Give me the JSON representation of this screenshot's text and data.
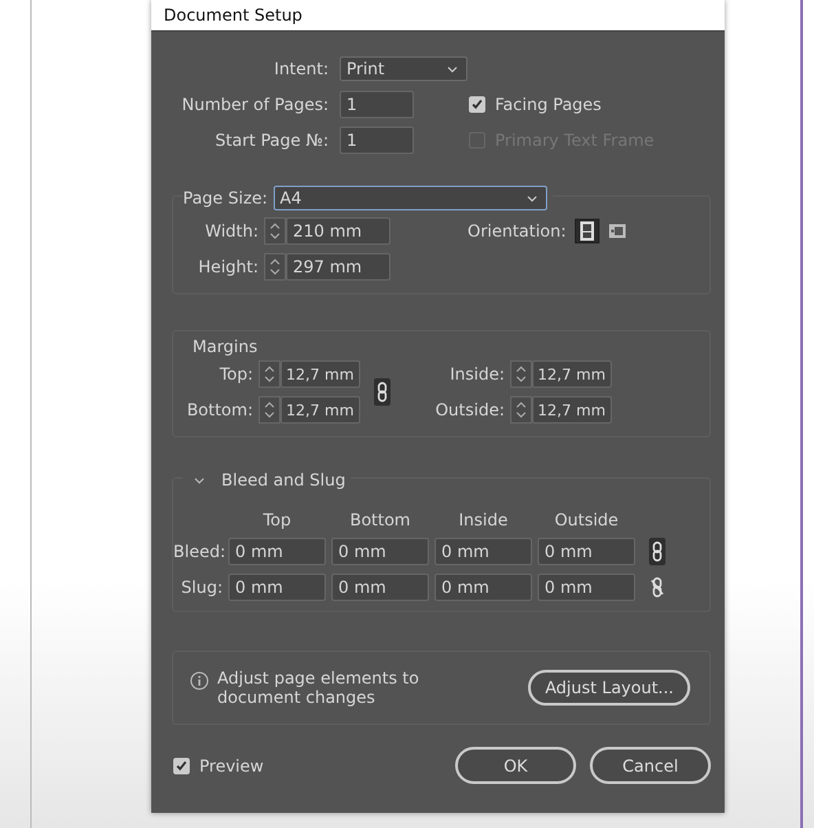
{
  "window": {
    "title": "Document Setup"
  },
  "intent": {
    "label": "Intent:",
    "value": "Print"
  },
  "number_of_pages": {
    "label": "Number of Pages:",
    "value": "1"
  },
  "start_page": {
    "label": "Start Page №:",
    "value": "1"
  },
  "facing_pages": {
    "label": "Facing Pages",
    "checked": true,
    "disabled": false
  },
  "primary_text_frame": {
    "label": "Primary Text Frame",
    "checked": false,
    "disabled": true
  },
  "page_size": {
    "label": "Page Size:",
    "value": "A4",
    "width": {
      "label": "Width:",
      "value": "210 mm"
    },
    "height": {
      "label": "Height:",
      "value": "297 mm"
    },
    "orientation": {
      "label": "Orientation:",
      "options": [
        {
          "kind": "portrait",
          "selected": true
        },
        {
          "kind": "landscape",
          "selected": false
        }
      ]
    }
  },
  "margins": {
    "title": "Margins",
    "linked": true,
    "fields": [
      {
        "label": "Top:",
        "value": "12,7 mm"
      },
      {
        "label": "Inside:",
        "value": "12,7 mm"
      },
      {
        "label": "Bottom:",
        "value": "12,7 mm"
      },
      {
        "label": "Outside:",
        "value": "12,7 mm"
      }
    ]
  },
  "bleed_and_slug": {
    "title": "Bleed and Slug",
    "expanded": true,
    "columns": [
      "Top",
      "Bottom",
      "Inside",
      "Outside"
    ],
    "rows": [
      {
        "label": "Bleed:",
        "values": [
          "0 mm",
          "0 mm",
          "0 mm",
          "0 mm"
        ],
        "linked": true
      },
      {
        "label": "Slug:",
        "values": [
          "0 mm",
          "0 mm",
          "0 mm",
          "0 mm"
        ],
        "linked": false
      }
    ]
  },
  "adjust": {
    "text": "Adjust page elements to document changes",
    "button": "Adjust Layout..."
  },
  "preview": {
    "label": "Preview",
    "checked": true
  },
  "buttons": [
    "OK",
    "Cancel"
  ]
}
